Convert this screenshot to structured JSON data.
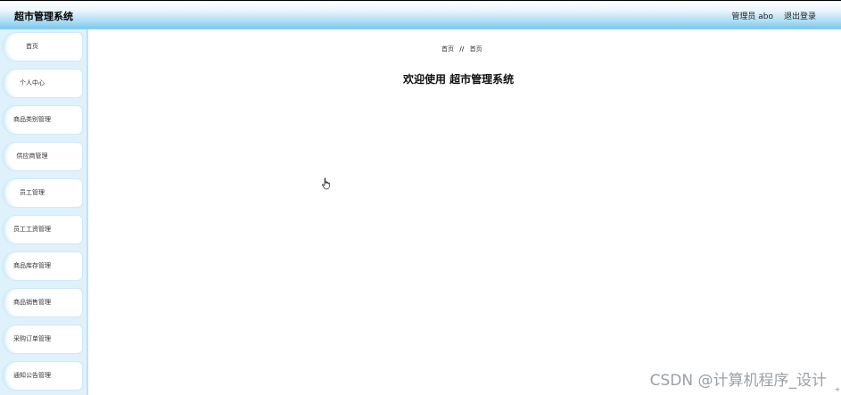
{
  "header": {
    "title": "超市管理系统",
    "user_label": "管理员 abo",
    "logout_label": "退出登录"
  },
  "sidebar": {
    "items": [
      {
        "label": "首页"
      },
      {
        "label": "个人中心"
      },
      {
        "label": "商品类别管理"
      },
      {
        "label": "供应商管理"
      },
      {
        "label": "员工管理"
      },
      {
        "label": "员工工资管理"
      },
      {
        "label": "商品库存管理"
      },
      {
        "label": "商品销售管理"
      },
      {
        "label": "采购订单管理"
      },
      {
        "label": "通知公告管理"
      }
    ]
  },
  "breadcrumb": {
    "home": "首页",
    "separator": "//",
    "current": "首页"
  },
  "main": {
    "welcome": "欢迎使用 超市管理系统"
  },
  "watermark": "CSDN @计算机程序_设计",
  "colors": {
    "header_gradient_end": "#7cc8ee",
    "sidebar_bg": "#dff1fb"
  },
  "icons": {
    "cursor": "hand-pointer-icon"
  }
}
